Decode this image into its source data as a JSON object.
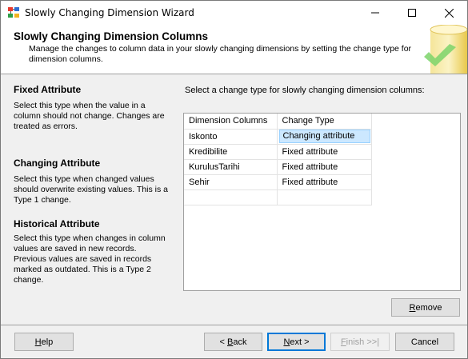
{
  "window": {
    "title": "Slowly Changing Dimension Wizard"
  },
  "header": {
    "title": "Slowly Changing Dimension Columns",
    "description": "Manage the changes to column data in your slowly changing dimensions by setting the change type for dimension columns."
  },
  "sections": [
    {
      "title": "Fixed Attribute",
      "text": "Select this type when the value in a column should not change. Changes are treated as errors."
    },
    {
      "title": "Changing Attribute",
      "text": "Select this type when changed values should overwrite existing values. This is a Type 1 change."
    },
    {
      "title": "Historical Attribute",
      "text": "Select this type when changes in column values are saved in new records. Previous values are saved in records marked as outdated. This is a Type 2 change."
    }
  ],
  "instruction": "Select a change type for slowly changing dimension columns:",
  "grid": {
    "columns": [
      "Dimension Columns",
      "Change Type"
    ],
    "rows": [
      {
        "column": "Iskonto",
        "type": "Changing attribute"
      },
      {
        "column": "Kredibilite",
        "type": "Fixed attribute"
      },
      {
        "column": "KurulusTarihi",
        "type": "Fixed attribute"
      },
      {
        "column": "Sehir",
        "type": "Fixed attribute"
      }
    ]
  },
  "buttons": {
    "remove": {
      "accel": "R",
      "rest": "emove"
    },
    "help": {
      "accel": "H",
      "rest": "elp"
    },
    "back": {
      "pre": "< ",
      "accel": "B",
      "rest": "ack"
    },
    "next": {
      "accel": "N",
      "rest": "ext >"
    },
    "finish": {
      "accel": "F",
      "rest": "inish >>|"
    },
    "cancel": "Cancel"
  }
}
